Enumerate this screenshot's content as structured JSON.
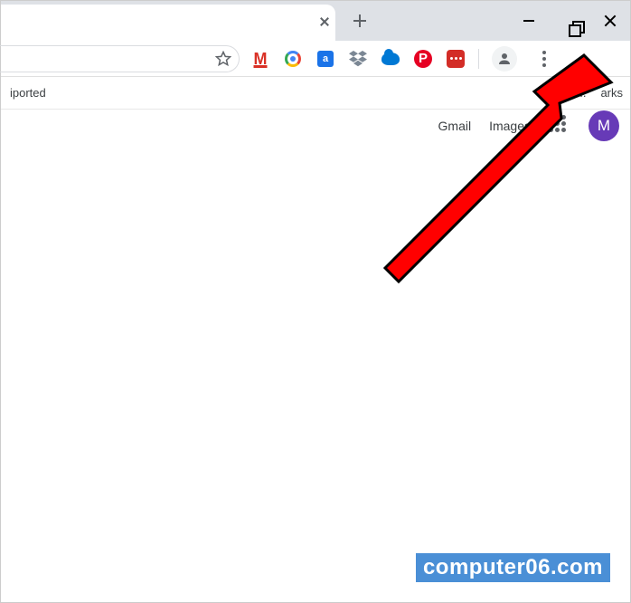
{
  "bookmarks": {
    "left_text": "iported",
    "items": [
      {
        "label": "O..."
      },
      {
        "label": "arks"
      }
    ]
  },
  "page": {
    "links": {
      "gmail": "Gmail",
      "images": "Images"
    },
    "avatar_letter": "M"
  },
  "watermark": "computer06.com",
  "icons": {
    "tag_letter": "a",
    "pinterest_letter": "P"
  }
}
